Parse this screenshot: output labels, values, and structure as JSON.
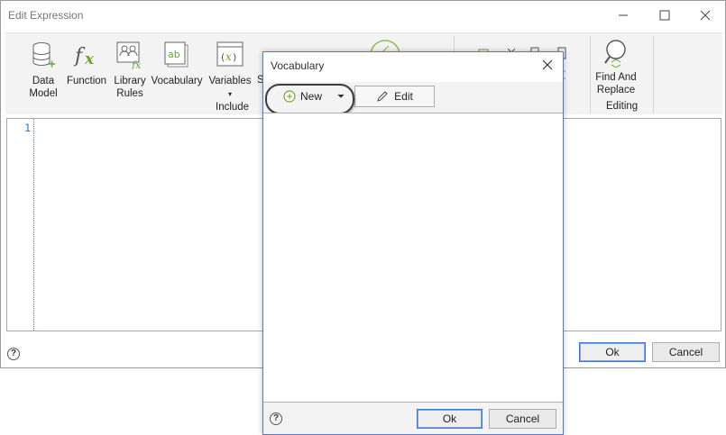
{
  "main_window": {
    "title": "Edit Expression",
    "ribbon": {
      "buttons": [
        {
          "line1": "Data",
          "line2": "Model",
          "icon": "database-icon"
        },
        {
          "line1": "Function",
          "line2": "",
          "icon": "function-icon"
        },
        {
          "line1": "Library",
          "line2": "Rules",
          "icon": "library-rules-icon"
        },
        {
          "line1": "Vocabulary",
          "line2": "",
          "icon": "vocabulary-icon"
        },
        {
          "line1": "Variables",
          "line2": "▾",
          "icon": "variables-icon"
        },
        {
          "line1": "Find And",
          "line2": "Replace",
          "icon": "find-replace-icon"
        }
      ],
      "partial_label": "S",
      "groups": {
        "include": "Include",
        "editing": "Editing"
      }
    },
    "editor": {
      "line_numbers": [
        "1"
      ]
    },
    "footer": {
      "help": "?",
      "ok_label": "Ok",
      "cancel_label": "Cancel"
    }
  },
  "dialog": {
    "title": "Vocabulary",
    "toolbar": {
      "new_label": "New",
      "edit_label": "Edit"
    },
    "footer": {
      "help": "?",
      "ok_label": "Ok",
      "cancel_label": "Cancel"
    }
  },
  "colors": {
    "accent": "#3b77d6",
    "function_green": "#6aa82c",
    "gutter_blue": "#2b6fd6"
  }
}
